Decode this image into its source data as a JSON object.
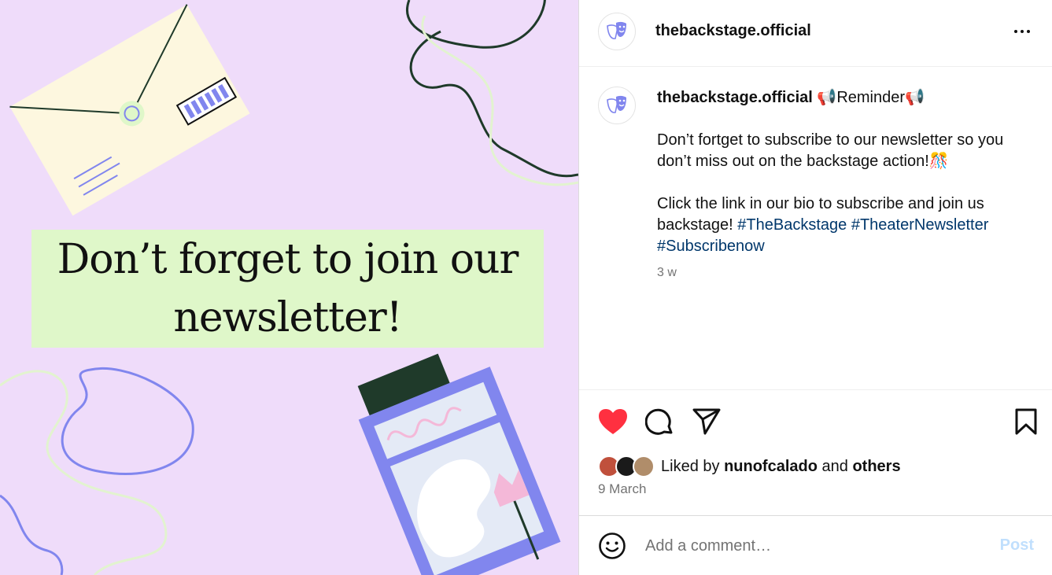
{
  "post_image": {
    "headline": "Don’t forget to join our newsletter!"
  },
  "header": {
    "username": "thebackstage.official",
    "avatar_icon": "theater-masks-icon",
    "more_icon": "more-options-icon"
  },
  "caption": {
    "username": "thebackstage.official",
    "title_prefix_emoji": "📢",
    "title": "Reminder",
    "title_suffix_emoji": "📢",
    "paragraph1": "Don’t fortget to subscribe to our newsletter so you don’t miss out on the backstage action!",
    "paragraph1_emoji": "🎊",
    "paragraph2": "Click the link in our bio to subscribe and join us backstage!",
    "hashtags": [
      "#TheBackstage",
      "#TheaterNewsletter",
      "#Subscribenow"
    ],
    "time_ago": "3 w"
  },
  "actions": {
    "like_icon": "heart-filled-icon",
    "comment_icon": "comment-icon",
    "share_icon": "share-icon",
    "save_icon": "bookmark-icon",
    "like_color": "#ff3040"
  },
  "likes": {
    "prefix": "Liked by",
    "user": "nunofcalado",
    "conjunction": "and",
    "others": "others"
  },
  "post_date": "9 March",
  "comment": {
    "placeholder": "Add a comment…",
    "post_label": "Post",
    "emoji_icon": "smiley-icon"
  },
  "colors": {
    "image_background": "#efdcfa",
    "headline_box": "#dff7c9",
    "hashtag": "#00376b",
    "post_button": "#c0dffd",
    "accent_purple": "#8186ee"
  }
}
